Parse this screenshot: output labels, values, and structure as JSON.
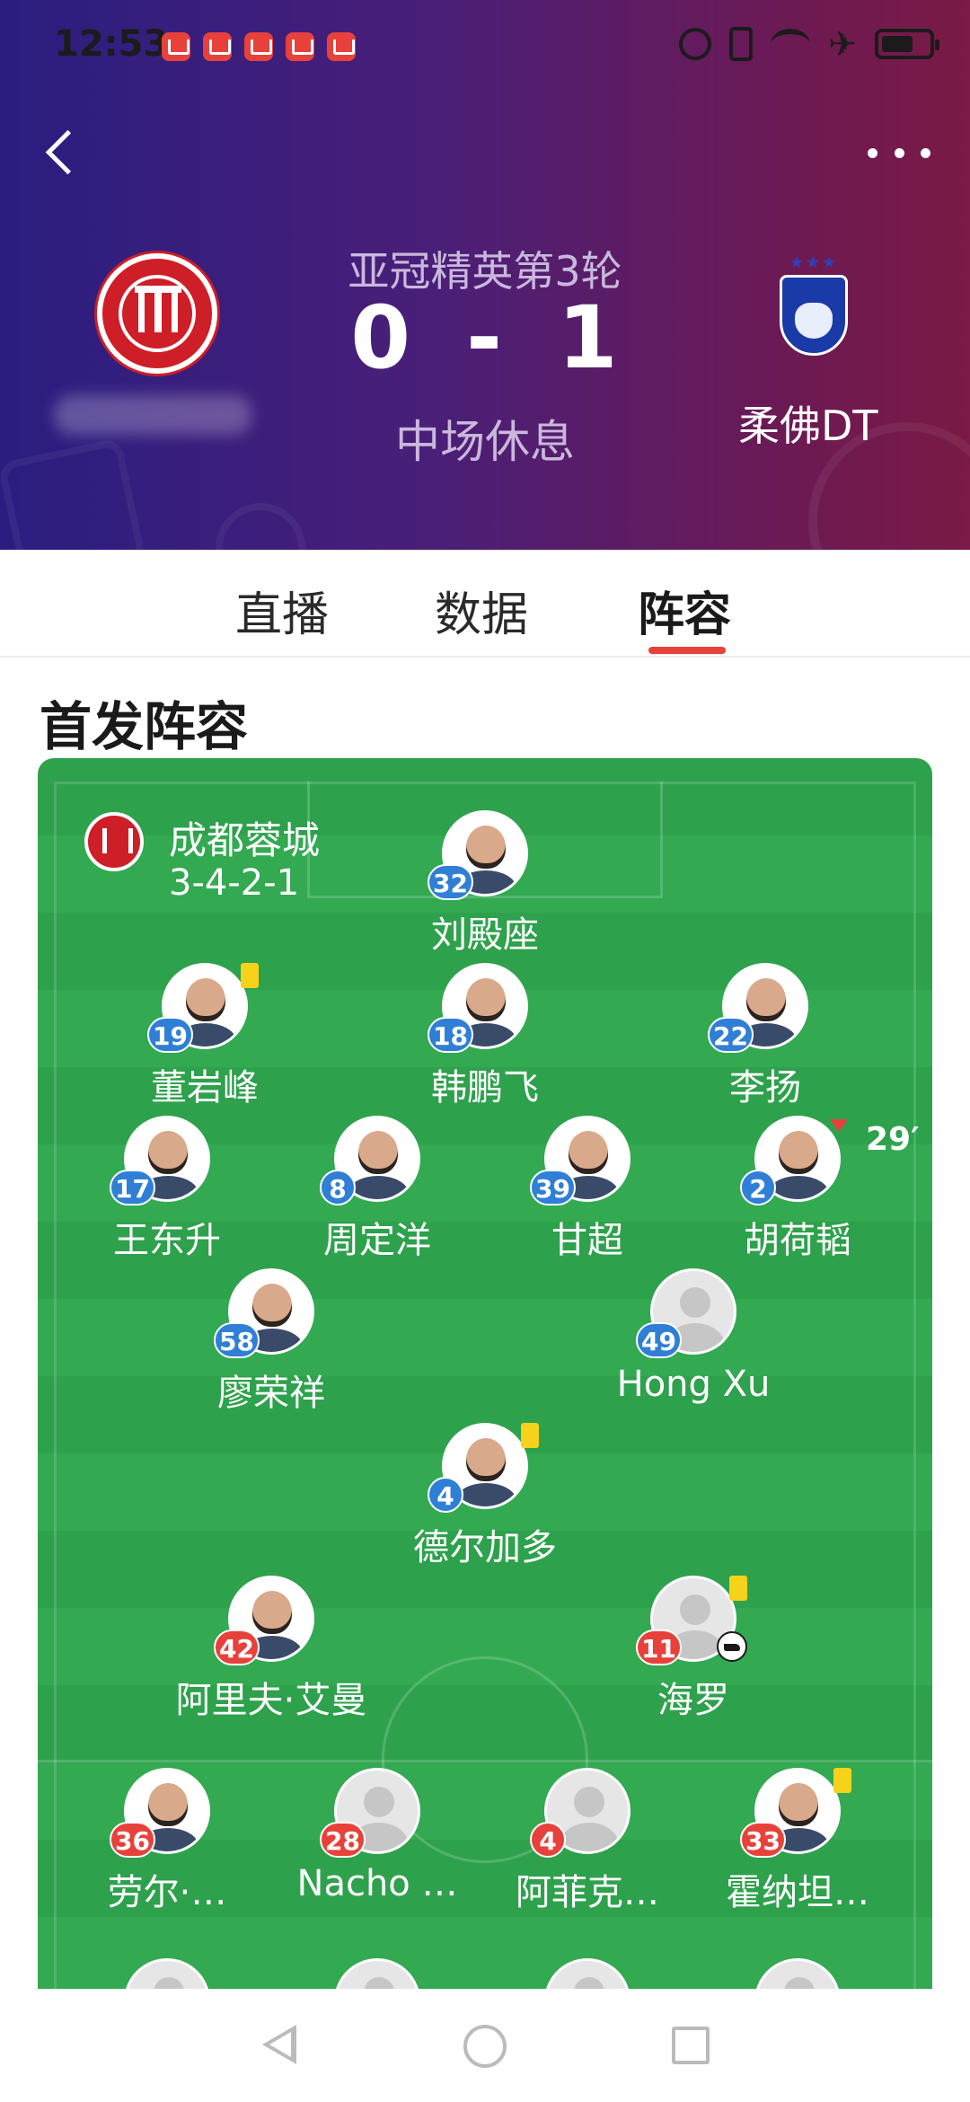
{
  "status_bar": {
    "time": "12:53"
  },
  "header": {
    "round": "亚冠精英第3轮",
    "home_score": "0",
    "separator": "-",
    "away_score": "1",
    "status": "中场休息",
    "away_team": "柔佛DT"
  },
  "tabs": [
    {
      "label": "直播"
    },
    {
      "label": "数据"
    },
    {
      "label": "阵容"
    }
  ],
  "lineup": {
    "section_title": "首发阵容",
    "team_name": "成都蓉城",
    "formation": "3-4-2-1",
    "home_players": [
      {
        "number": "32",
        "name": "刘殿座"
      },
      {
        "number": "19",
        "name": "董岩峰"
      },
      {
        "number": "18",
        "name": "韩鹏飞"
      },
      {
        "number": "22",
        "name": "李扬"
      },
      {
        "number": "17",
        "name": "王东升"
      },
      {
        "number": "8",
        "name": "周定洋"
      },
      {
        "number": "39",
        "name": "甘超"
      },
      {
        "number": "2",
        "name": "胡荷韬",
        "sub_time": "29′"
      },
      {
        "number": "58",
        "name": "廖荣祥"
      },
      {
        "number": "49",
        "name": "Hong Xu"
      },
      {
        "number": "4",
        "name": "德尔加多"
      }
    ],
    "away_players": [
      {
        "number": "42",
        "name": "阿里夫·艾曼"
      },
      {
        "number": "11",
        "name": "海罗"
      },
      {
        "number": "36",
        "name": "劳尔·…"
      },
      {
        "number": "28",
        "name": "Nacho …"
      },
      {
        "number": "4",
        "name": "阿菲克…"
      },
      {
        "number": "33",
        "name": "霍纳坦…"
      }
    ]
  },
  "colors": {
    "accent": "#e8413b",
    "pitch": "#2ea14c",
    "home_number": "#2f7fd6",
    "away_number": "#e8413b"
  }
}
